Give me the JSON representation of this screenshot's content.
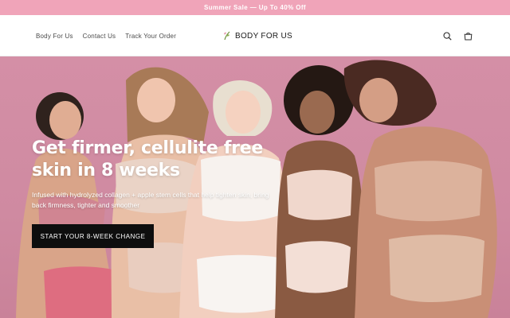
{
  "announcement": {
    "text": "Summer Sale — Up To 40% Off"
  },
  "nav": {
    "items": [
      {
        "label": "Body For Us"
      },
      {
        "label": "Contact Us"
      },
      {
        "label": "Track Your Order"
      }
    ]
  },
  "brand": {
    "name": "BODY FOR US"
  },
  "header_icons": {
    "search": "search-icon",
    "cart": "cart-icon"
  },
  "hero": {
    "title_line1": "Get firmer, cellulite free",
    "title_line2": "skin in 8 weeks",
    "subtitle": "Infused with hydrolyzed collagen + apple stem cells that help tighten skin, bring back firmness, tighter and smoother",
    "cta": "START YOUR 8-WEEK CHANGE"
  },
  "colors": {
    "announcement_bg": "#f0a4b9",
    "hero_bg": "#d48fa6",
    "cta_bg": "#0e0e0e",
    "text_light": "#ffffff",
    "nav_text": "#4a4a4a"
  }
}
